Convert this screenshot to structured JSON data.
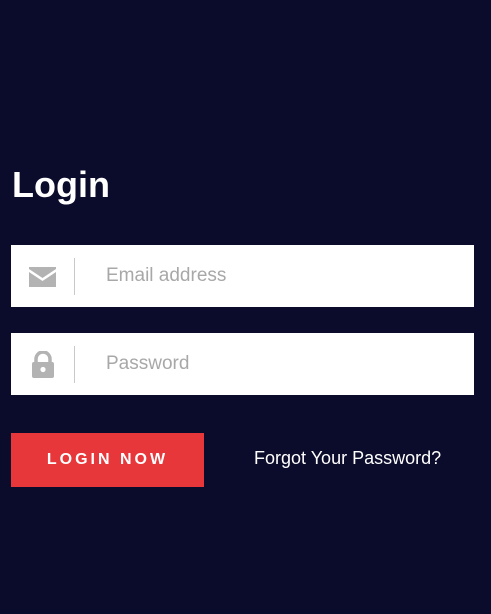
{
  "login": {
    "title": "Login",
    "email": {
      "icon": "envelope-icon",
      "placeholder": "Email address",
      "value": ""
    },
    "password": {
      "icon": "lock-icon",
      "placeholder": "Password",
      "value": ""
    },
    "submit_label": "LOGIN NOW",
    "forgot_label": "Forgot Your Password?"
  },
  "colors": {
    "background": "#0b0b2b",
    "accent": "#e8373a",
    "field_background": "#ffffff",
    "icon": "#b3b3b3",
    "placeholder": "#a8a8a8"
  }
}
